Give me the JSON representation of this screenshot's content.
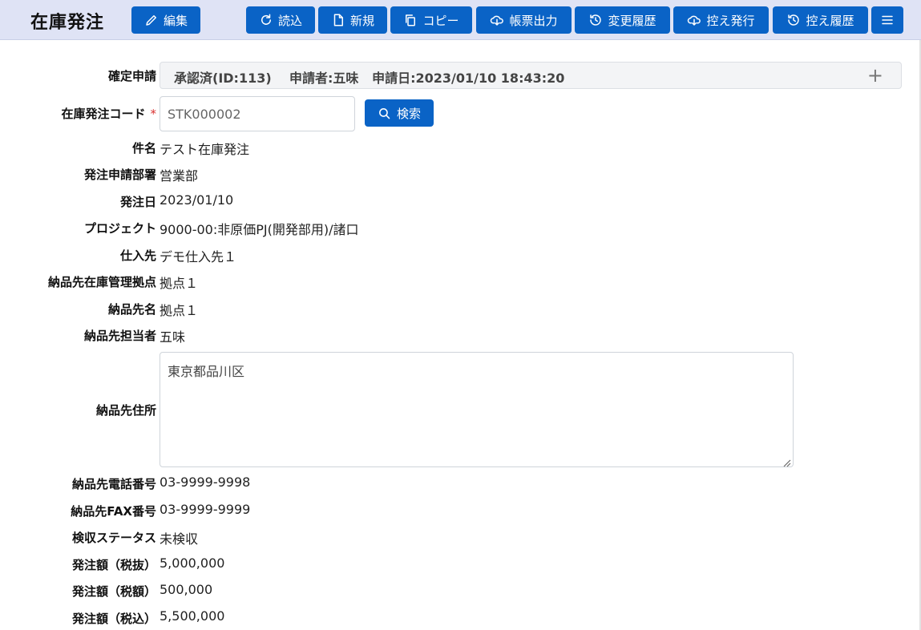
{
  "header": {
    "title": "在庫発注",
    "buttons": {
      "edit": "編集",
      "reload": "読込",
      "new": "新規",
      "copy": "コピー",
      "report": "帳票出力",
      "change_history": "変更履歴",
      "copy_issue": "控え発行",
      "copy_history": "控え履歴"
    }
  },
  "form": {
    "approval": {
      "label": "確定申請",
      "status": "承認済(ID:113)",
      "applicant": "申請者:五味",
      "date": "申請日:2023/01/10 18:43:20"
    },
    "code": {
      "label": "在庫発注コード",
      "required_mark": "*",
      "value": "STK000002"
    },
    "search_label": "検索",
    "subject": {
      "label": "件名",
      "value": "テスト在庫発注"
    },
    "department": {
      "label": "発注申請部署",
      "value": "営業部"
    },
    "order_date": {
      "label": "発注日",
      "value": "2023/01/10"
    },
    "project": {
      "label": "プロジェクト",
      "value": "9000-00:非原価PJ(開発部用)/諸口"
    },
    "supplier": {
      "label": "仕入先",
      "value": "デモ仕入先１"
    },
    "delivery_base": {
      "label": "納品先在庫管理拠点",
      "value": "拠点１"
    },
    "delivery_name": {
      "label": "納品先名",
      "value": "拠点１"
    },
    "delivery_person": {
      "label": "納品先担当者",
      "value": "五味"
    },
    "delivery_address": {
      "label": "納品先住所",
      "value": "東京都品川区"
    },
    "delivery_phone": {
      "label": "納品先電話番号",
      "value": "03-9999-9998"
    },
    "delivery_fax": {
      "label": "納品先FAX番号",
      "value": "03-9999-9999"
    },
    "inspection_status": {
      "label": "検収ステータス",
      "value": "未検収"
    },
    "amount_excl": {
      "label": "発注額（税抜）",
      "value": "5,000,000"
    },
    "amount_tax": {
      "label": "発注額（税額）",
      "value": "500,000"
    },
    "amount_incl": {
      "label": "発注額（税込）",
      "value": "5,500,000"
    }
  },
  "colors": {
    "accent": "#0a63c6",
    "header_bg": "#dfe3f5",
    "required": "#d9302f"
  }
}
